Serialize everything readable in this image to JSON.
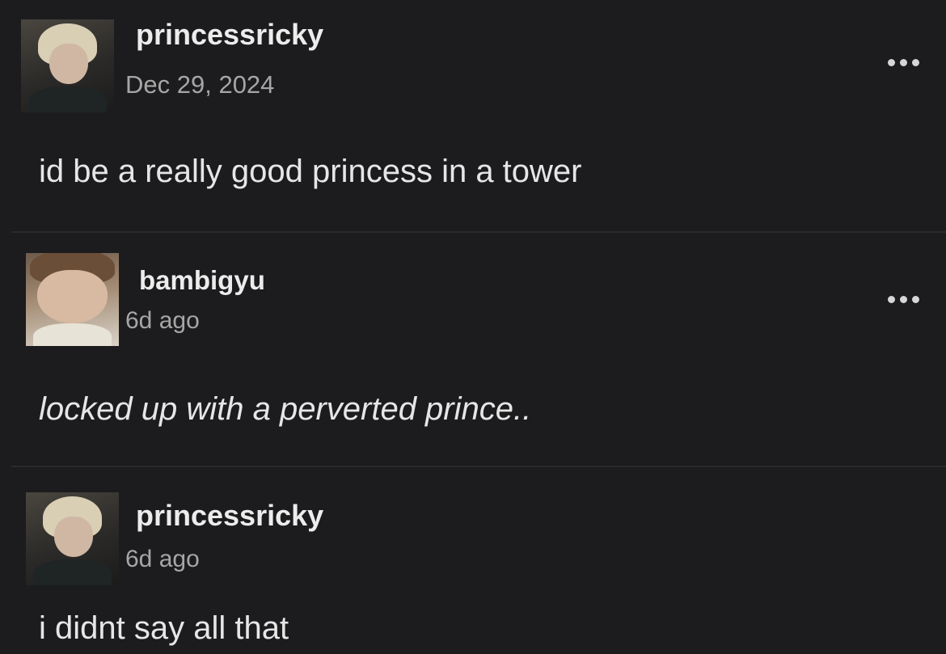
{
  "thread": {
    "posts": [
      {
        "username": "princessricky",
        "timestamp": "Dec 29, 2024",
        "text": "id be a really good princess in a tower",
        "has_menu": true
      },
      {
        "username": "bambigyu",
        "timestamp": "6d ago",
        "text": "locked up with a perverted prince..",
        "has_menu": true
      },
      {
        "username": "princessricky",
        "timestamp": "6d ago",
        "text": "i didnt say all that",
        "has_menu": false
      }
    ]
  },
  "icons": {
    "menu": "more-options-icon"
  },
  "colors": {
    "background": "#1c1c1e",
    "username": "#ececec",
    "timestamp": "#a6a6a6",
    "body_text": "#e6e6e6",
    "divider": "#2a2a2d"
  }
}
